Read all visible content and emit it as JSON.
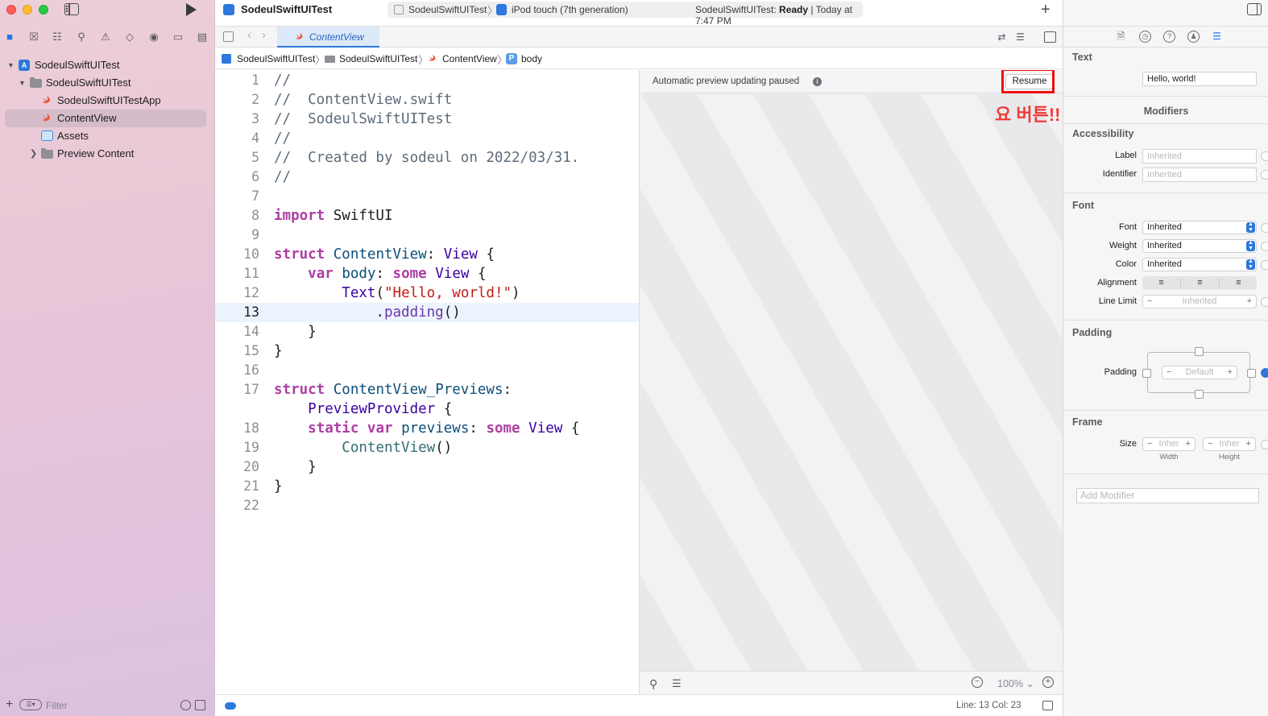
{
  "window": {
    "project_title": "SodeulSwiftUITest"
  },
  "sidebar": {
    "tree": [
      {
        "label": "SodeulSwiftUITest",
        "kind": "project",
        "icon": "project-icon"
      },
      {
        "label": "SodeulSwiftUITest",
        "kind": "group",
        "icon": "folder-icon"
      },
      {
        "label": "SodeulSwiftUITestApp",
        "kind": "file",
        "icon": "swift-file-icon"
      },
      {
        "label": "ContentView",
        "kind": "file",
        "icon": "swift-file-icon",
        "selected": true
      },
      {
        "label": "Assets",
        "kind": "asset-catalog",
        "icon": "assets-icon"
      },
      {
        "label": "Preview Content",
        "kind": "group",
        "icon": "folder-icon",
        "collapsed": true
      }
    ],
    "filter_placeholder": "Filter"
  },
  "toolbar": {
    "scheme": "SodeulSwiftUITest",
    "destination": "iPod touch (7th generation)",
    "status_prefix": "SodeulSwiftUITest: ",
    "status_state": "Ready",
    "status_time": " | Today at 7:47 PM",
    "add_symbol": "+"
  },
  "tabbar": {
    "active_tab": "ContentView"
  },
  "jumpbar": {
    "crumbs": [
      "SodeulSwiftUITest",
      "SodeulSwiftUITest",
      "ContentView",
      "body"
    ]
  },
  "editor": {
    "current_line": 13,
    "line_numbers": [
      "1",
      "2",
      "3",
      "4",
      "5",
      "6",
      "7",
      "8",
      "9",
      "10",
      "11",
      "12",
      "13",
      "14",
      "15",
      "16",
      "17",
      "",
      "18",
      "19",
      "20",
      "21",
      "22"
    ],
    "lines": [
      [
        {
          "t": "//",
          "c": "com"
        }
      ],
      [
        {
          "t": "//  ContentView.swift",
          "c": "com"
        }
      ],
      [
        {
          "t": "//  SodeulSwiftUITest",
          "c": "com"
        }
      ],
      [
        {
          "t": "//",
          "c": "com"
        }
      ],
      [
        {
          "t": "//  Created by sodeul on 2022/03/31.",
          "c": "com"
        }
      ],
      [
        {
          "t": "//",
          "c": "com"
        }
      ],
      [],
      [
        {
          "t": "import",
          "c": "kw"
        },
        {
          "t": " SwiftUI",
          "c": ""
        }
      ],
      [],
      [
        {
          "t": "struct",
          "c": "kw"
        },
        {
          "t": " ",
          "c": ""
        },
        {
          "t": "ContentView",
          "c": "type"
        },
        {
          "t": ": ",
          "c": ""
        },
        {
          "t": "View",
          "c": "type2"
        },
        {
          "t": " {",
          "c": ""
        }
      ],
      [
        {
          "t": "    ",
          "c": ""
        },
        {
          "t": "var",
          "c": "kw"
        },
        {
          "t": " ",
          "c": ""
        },
        {
          "t": "body",
          "c": "type"
        },
        {
          "t": ": ",
          "c": ""
        },
        {
          "t": "some",
          "c": "kw"
        },
        {
          "t": " ",
          "c": ""
        },
        {
          "t": "View",
          "c": "type2"
        },
        {
          "t": " {",
          "c": ""
        }
      ],
      [
        {
          "t": "        ",
          "c": ""
        },
        {
          "t": "Text",
          "c": "type2"
        },
        {
          "t": "(",
          "c": ""
        },
        {
          "t": "\"Hello, world!\"",
          "c": "str"
        },
        {
          "t": ")",
          "c": ""
        }
      ],
      [
        {
          "t": "            .",
          "c": ""
        },
        {
          "t": "padding",
          "c": "prop"
        },
        {
          "t": "()",
          "c": ""
        }
      ],
      [
        {
          "t": "    }",
          "c": ""
        }
      ],
      [
        {
          "t": "}",
          "c": ""
        }
      ],
      [],
      [
        {
          "t": "struct",
          "c": "kw"
        },
        {
          "t": " ",
          "c": ""
        },
        {
          "t": "ContentView_Previews",
          "c": "type"
        },
        {
          "t": ":",
          "c": ""
        }
      ],
      [
        {
          "t": "    ",
          "c": ""
        },
        {
          "t": "PreviewProvider",
          "c": "type2"
        },
        {
          "t": " {",
          "c": ""
        }
      ],
      [
        {
          "t": "    ",
          "c": ""
        },
        {
          "t": "static",
          "c": "kw"
        },
        {
          "t": " ",
          "c": ""
        },
        {
          "t": "var",
          "c": "kw"
        },
        {
          "t": " ",
          "c": ""
        },
        {
          "t": "previews",
          "c": "type"
        },
        {
          "t": ": ",
          "c": ""
        },
        {
          "t": "some",
          "c": "kw"
        },
        {
          "t": " ",
          "c": ""
        },
        {
          "t": "View",
          "c": "type2"
        },
        {
          "t": " {",
          "c": ""
        }
      ],
      [
        {
          "t": "        ",
          "c": ""
        },
        {
          "t": "ContentView",
          "c": "fn"
        },
        {
          "t": "()",
          "c": ""
        }
      ],
      [
        {
          "t": "    }",
          "c": ""
        }
      ],
      [
        {
          "t": "}",
          "c": ""
        }
      ],
      []
    ]
  },
  "preview": {
    "message": "Automatic preview updating paused",
    "resume_label": "Resume",
    "annotation": "요 버튼!!",
    "annotation_color": "#f23a3a",
    "zoom": "100%"
  },
  "status": {
    "position": "Line: 13  Col: 23"
  },
  "inspector": {
    "text_section": "Text",
    "text_value": "Hello, world!",
    "modifiers_title": "Modifiers",
    "accessibility": {
      "title": "Accessibility",
      "label_label": "Label",
      "label_placeholder": "Inherited",
      "identifier_label": "Identifier",
      "identifier_placeholder": "Inherited"
    },
    "font": {
      "title": "Font",
      "font_label": "Font",
      "font_value": "Inherited",
      "weight_label": "Weight",
      "weight_value": "Inherited",
      "color_label": "Color",
      "color_value": "Inherited",
      "alignment_label": "Alignment",
      "line_limit_label": "Line Limit",
      "line_limit_value": "Inherited"
    },
    "padding": {
      "title": "Padding",
      "row_label": "Padding",
      "value": "Default"
    },
    "frame": {
      "title": "Frame",
      "size_label": "Size",
      "width_value": "Inher",
      "height_value": "Inher",
      "width_caption": "Width",
      "height_caption": "Height"
    },
    "add_modifier_placeholder": "Add Modifier"
  },
  "colors": {
    "accent": "#2c78dd",
    "highlight_box": "#f20c0c"
  }
}
